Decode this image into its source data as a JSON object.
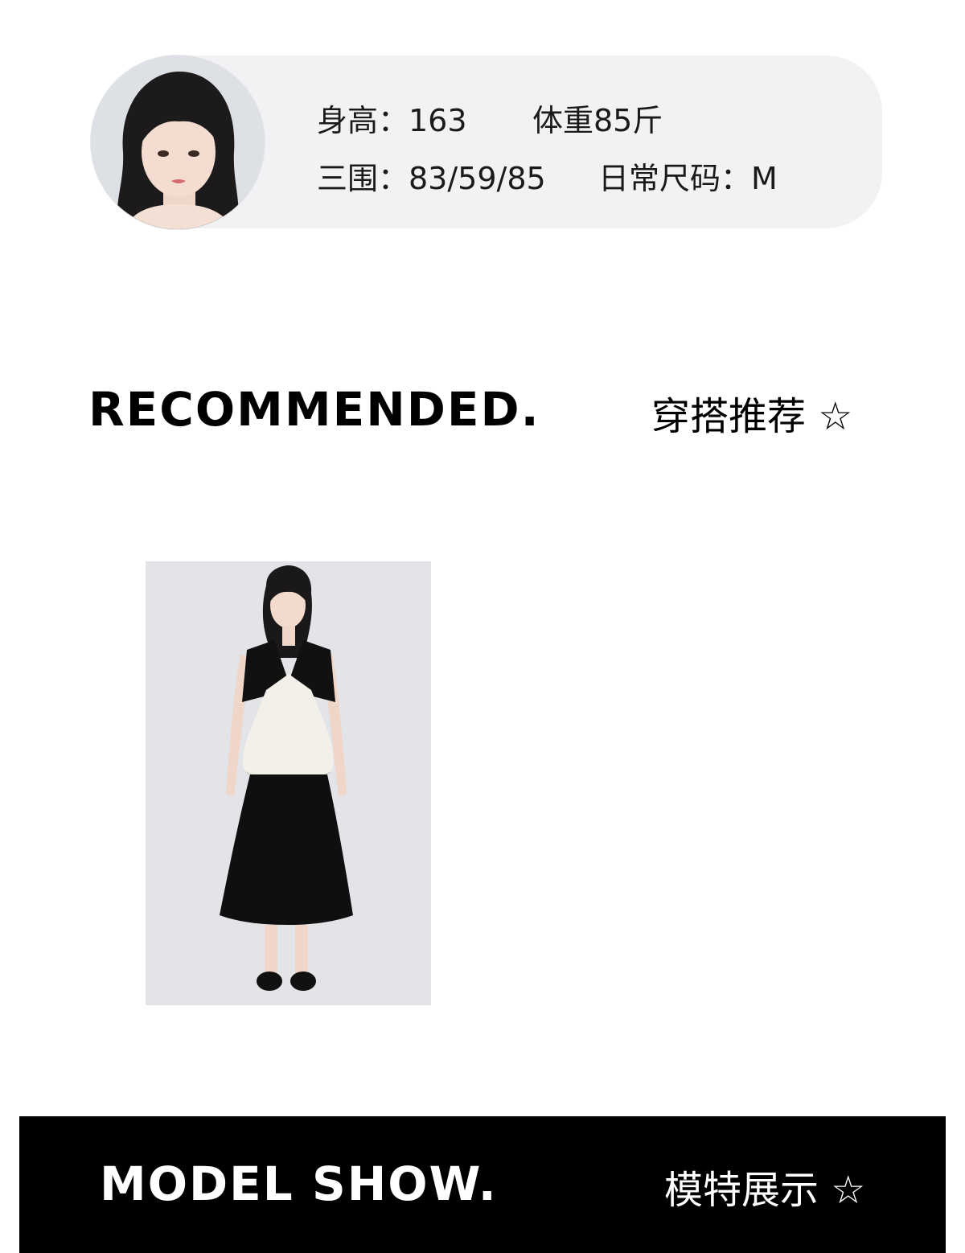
{
  "model_info": {
    "avatar_icon": "model-portrait-photo",
    "height": "身高：163",
    "weight": "体重85斤",
    "measurements": "三围：83/59/85",
    "size": "日常尺码：M"
  },
  "recommended": {
    "title_en": "RECOMMENDED.",
    "title_cn": "穿搭推荐 ☆"
  },
  "product": {
    "photo_icon": "dress-model-photo"
  },
  "model_show": {
    "title_en": "MODEL SHOW.",
    "title_cn": "模特展示 ☆"
  },
  "colors": {
    "card_bg": "#f2f2f4",
    "banner_bg": "#000000",
    "photo_bg": "#e3e5e8"
  }
}
